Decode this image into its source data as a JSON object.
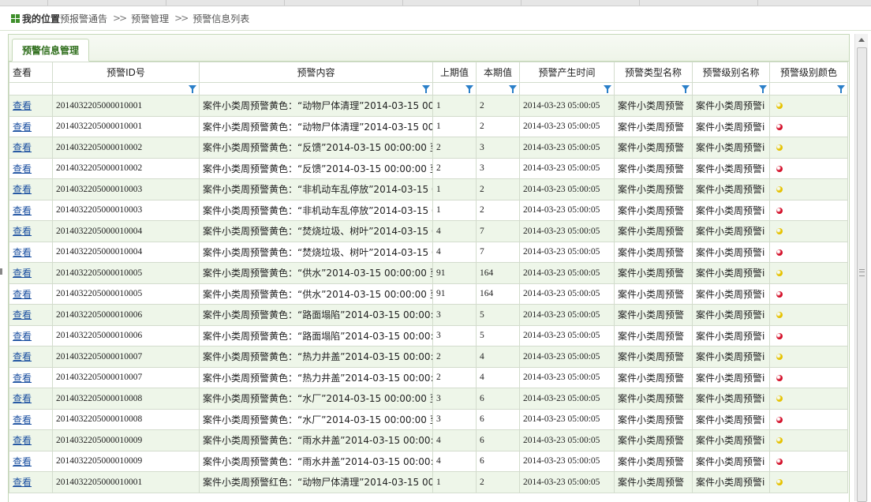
{
  "breadcrumb": {
    "title": "我的位置",
    "items": [
      "预报警通告",
      "预警管理",
      "预警信息列表"
    ],
    "separator": ">>"
  },
  "tab": {
    "label": "预警信息管理"
  },
  "columns": [
    "查看",
    "预警ID号",
    "预警内容",
    "上期值",
    "本期值",
    "预警产生时间",
    "预警类型名称",
    "预警级别名称",
    "预警级别颜色"
  ],
  "colors": {
    "yellow": "#e6c200",
    "red": "#d4102a",
    "link": "#1a4fa0",
    "accent": "#2f6e1c"
  },
  "rows": [
    {
      "view": "查看",
      "id": "2014032205000010001",
      "content": "案件小类周预警黄色：“动物尸体清理”2014-03-15 00:0(",
      "prev": "1",
      "curr": "2",
      "time": "2014-03-23 05:00:05",
      "type": "案件小类周预警",
      "level": "案件小类周预警i",
      "color": "yellow"
    },
    {
      "view": "查看",
      "id": "2014032205000010001",
      "content": "案件小类周预警黄色：“动物尸体清理”2014-03-15 00:0(",
      "prev": "1",
      "curr": "2",
      "time": "2014-03-23 05:00:05",
      "type": "案件小类周预警",
      "level": "案件小类周预警i",
      "color": "red"
    },
    {
      "view": "查看",
      "id": "2014032205000010002",
      "content": "案件小类周预警黄色：“反馈”2014-03-15 00:00:00 至 20",
      "prev": "2",
      "curr": "3",
      "time": "2014-03-23 05:00:05",
      "type": "案件小类周预警",
      "level": "案件小类周预警i",
      "color": "yellow"
    },
    {
      "view": "查看",
      "id": "2014032205000010002",
      "content": "案件小类周预警黄色：“反馈”2014-03-15 00:00:00 至 20",
      "prev": "2",
      "curr": "3",
      "time": "2014-03-23 05:00:05",
      "type": "案件小类周预警",
      "level": "案件小类周预警i",
      "color": "red"
    },
    {
      "view": "查看",
      "id": "2014032205000010003",
      "content": "案件小类周预警黄色：“非机动车乱停放”2014-03-15 00",
      "prev": "1",
      "curr": "2",
      "time": "2014-03-23 05:00:05",
      "type": "案件小类周预警",
      "level": "案件小类周预警i",
      "color": "yellow"
    },
    {
      "view": "查看",
      "id": "2014032205000010003",
      "content": "案件小类周预警黄色：“非机动车乱停放”2014-03-15 00",
      "prev": "1",
      "curr": "2",
      "time": "2014-03-23 05:00:05",
      "type": "案件小类周预警",
      "level": "案件小类周预警i",
      "color": "red"
    },
    {
      "view": "查看",
      "id": "2014032205000010004",
      "content": "案件小类周预警黄色：“焚烧垃圾、树叶”2014-03-15 00",
      "prev": "4",
      "curr": "7",
      "time": "2014-03-23 05:00:05",
      "type": "案件小类周预警",
      "level": "案件小类周预警i",
      "color": "yellow"
    },
    {
      "view": "查看",
      "id": "2014032205000010004",
      "content": "案件小类周预警黄色：“焚烧垃圾、树叶”2014-03-15 00",
      "prev": "4",
      "curr": "7",
      "time": "2014-03-23 05:00:05",
      "type": "案件小类周预警",
      "level": "案件小类周预警i",
      "color": "red"
    },
    {
      "view": "查看",
      "id": "2014032205000010005",
      "content": "案件小类周预警黄色：“供水”2014-03-15 00:00:00 至 20",
      "prev": "91",
      "curr": "164",
      "time": "2014-03-23 05:00:05",
      "type": "案件小类周预警",
      "level": "案件小类周预警i",
      "color": "yellow"
    },
    {
      "view": "查看",
      "id": "2014032205000010005",
      "content": "案件小类周预警黄色：“供水”2014-03-15 00:00:00 至 20",
      "prev": "91",
      "curr": "164",
      "time": "2014-03-23 05:00:05",
      "type": "案件小类周预警",
      "level": "案件小类周预警i",
      "color": "red"
    },
    {
      "view": "查看",
      "id": "2014032205000010006",
      "content": "案件小类周预警黄色：“路面塌陷”2014-03-15 00:00:00 ;",
      "prev": "3",
      "curr": "5",
      "time": "2014-03-23 05:00:05",
      "type": "案件小类周预警",
      "level": "案件小类周预警i",
      "color": "yellow"
    },
    {
      "view": "查看",
      "id": "2014032205000010006",
      "content": "案件小类周预警黄色：“路面塌陷”2014-03-15 00:00:00 ;",
      "prev": "3",
      "curr": "5",
      "time": "2014-03-23 05:00:05",
      "type": "案件小类周预警",
      "level": "案件小类周预警i",
      "color": "red"
    },
    {
      "view": "查看",
      "id": "2014032205000010007",
      "content": "案件小类周预警黄色：“热力井盖”2014-03-15 00:00:00 ;",
      "prev": "2",
      "curr": "4",
      "time": "2014-03-23 05:00:05",
      "type": "案件小类周预警",
      "level": "案件小类周预警i",
      "color": "yellow"
    },
    {
      "view": "查看",
      "id": "2014032205000010007",
      "content": "案件小类周预警黄色：“热力井盖”2014-03-15 00:00:00 ;",
      "prev": "2",
      "curr": "4",
      "time": "2014-03-23 05:00:05",
      "type": "案件小类周预警",
      "level": "案件小类周预警i",
      "color": "red"
    },
    {
      "view": "查看",
      "id": "2014032205000010008",
      "content": "案件小类周预警黄色：“水厂”2014-03-15 00:00:00 至 20",
      "prev": "3",
      "curr": "6",
      "time": "2014-03-23 05:00:05",
      "type": "案件小类周预警",
      "level": "案件小类周预警i",
      "color": "yellow"
    },
    {
      "view": "查看",
      "id": "2014032205000010008",
      "content": "案件小类周预警黄色：“水厂”2014-03-15 00:00:00 至 20",
      "prev": "3",
      "curr": "6",
      "time": "2014-03-23 05:00:05",
      "type": "案件小类周预警",
      "level": "案件小类周预警i",
      "color": "red"
    },
    {
      "view": "查看",
      "id": "2014032205000010009",
      "content": "案件小类周预警黄色：“雨水井盖”2014-03-15 00:00:00 ;",
      "prev": "4",
      "curr": "6",
      "time": "2014-03-23 05:00:05",
      "type": "案件小类周预警",
      "level": "案件小类周预警i",
      "color": "yellow"
    },
    {
      "view": "查看",
      "id": "2014032205000010009",
      "content": "案件小类周预警黄色：“雨水井盖”2014-03-15 00:00:00 ;",
      "prev": "4",
      "curr": "6",
      "time": "2014-03-23 05:00:05",
      "type": "案件小类周预警",
      "level": "案件小类周预警i",
      "color": "red"
    },
    {
      "view": "查看",
      "id": "2014032205000010001",
      "content": "案件小类周预警红色：“动物尸体清理”2014-03-15 00:0(",
      "prev": "1",
      "curr": "2",
      "time": "2014-03-23 05:00:05",
      "type": "案件小类周预警",
      "level": "案件小类周预警i",
      "color": "yellow"
    }
  ]
}
